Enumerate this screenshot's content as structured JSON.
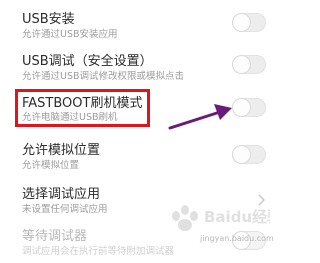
{
  "settings": [
    {
      "id": "usb-install",
      "title": "USB安装",
      "subtitle": "允许通过USB安装应用",
      "control": "toggle",
      "enabled": true,
      "checked": false
    },
    {
      "id": "usb-debug-security",
      "title": "USB调试（安全设置）",
      "subtitle": "允许通过USB调试修改权限或模拟点击",
      "control": "toggle",
      "enabled": true,
      "checked": false
    },
    {
      "id": "fastboot-mode",
      "title": "FASTBOOT刷机模式",
      "subtitle": "允许电脑通过USB刷机",
      "control": "toggle",
      "enabled": true,
      "checked": false
    },
    {
      "id": "mock-location",
      "title": "允许模拟位置",
      "subtitle": "允许模拟位置",
      "control": "toggle",
      "enabled": true,
      "checked": false
    },
    {
      "id": "select-debug-app",
      "title": "选择调试应用",
      "subtitle": "未设置任何调试应用",
      "control": "chevron",
      "enabled": true
    },
    {
      "id": "wait-debugger",
      "title": "等待调试器",
      "subtitle": "调试应用会在执行前等待附加调试器",
      "control": "toggle",
      "enabled": false,
      "checked": false
    }
  ],
  "annotation": {
    "highlight_color": "#e1141b",
    "arrow_color": "#6a1b7a",
    "highlighted_item": "fastboot-mode"
  },
  "watermark": {
    "brand": "Baidu经验",
    "url": "jingyan.baidu.com"
  },
  "icons": {
    "chevron": "chevron-right-icon",
    "arrow": "pointer-arrow-icon",
    "watermark": "baidu-paw-logo"
  }
}
